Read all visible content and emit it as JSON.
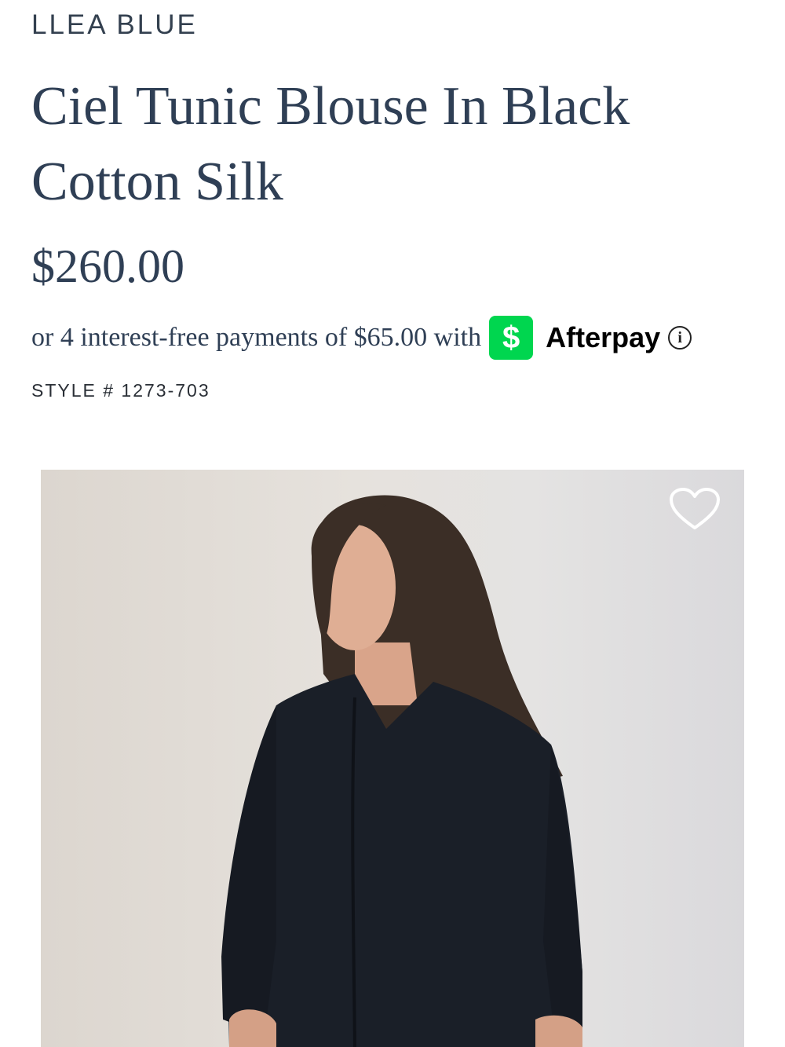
{
  "product": {
    "brand": "LLEA BLUE",
    "title": "Ciel Tunic Blouse In Black Cotton Silk",
    "price": "$260.00",
    "installment_text": "or 4 interest-free payments of $65.00 with",
    "cash_icon_symbol": "$",
    "afterpay_label": "Afterpay",
    "info_icon_symbol": "i",
    "style_code": "STYLE # 1273-703"
  },
  "photo": {
    "icon": "heart-icon"
  },
  "colors": {
    "text": "#2f3f55",
    "cash_green": "#00d64f",
    "afterpay_text": "#000000",
    "blouse": "#1a1f28"
  }
}
